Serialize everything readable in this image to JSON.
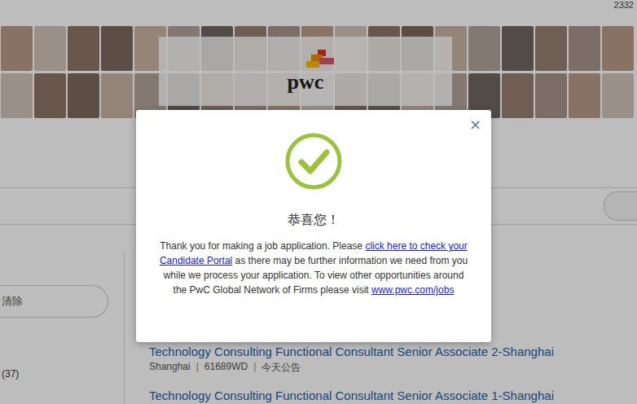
{
  "header": {
    "counter": "2332"
  },
  "banner": {
    "logo": "pwc"
  },
  "sidebar": {
    "filter_button": "清除",
    "counts": [
      "(37)"
    ]
  },
  "jobs": [
    {
      "title": "Technology Consulting Functional Consultant Senior Associate 2-Shanghai",
      "location": "Shanghai",
      "id": "61689WD",
      "posted": "今天公告",
      "separator": "|"
    },
    {
      "title": "Technology Consulting Functional Consultant Senior Associate 1-Shanghai"
    }
  ],
  "dialog": {
    "close": "×",
    "title": "恭喜您！",
    "message": [
      {
        "text": "Thank you for making a job application. Please ",
        "link": false
      },
      {
        "text": "click here to check your Candidate Portal",
        "link": true
      },
      {
        "text": " as there may be further information we need from you while we process your application. To view other opportunities around the PwC Global Network of Firms please visit ",
        "link": false
      },
      {
        "text": "www.pwc.com/jobs",
        "link": true
      }
    ]
  }
}
